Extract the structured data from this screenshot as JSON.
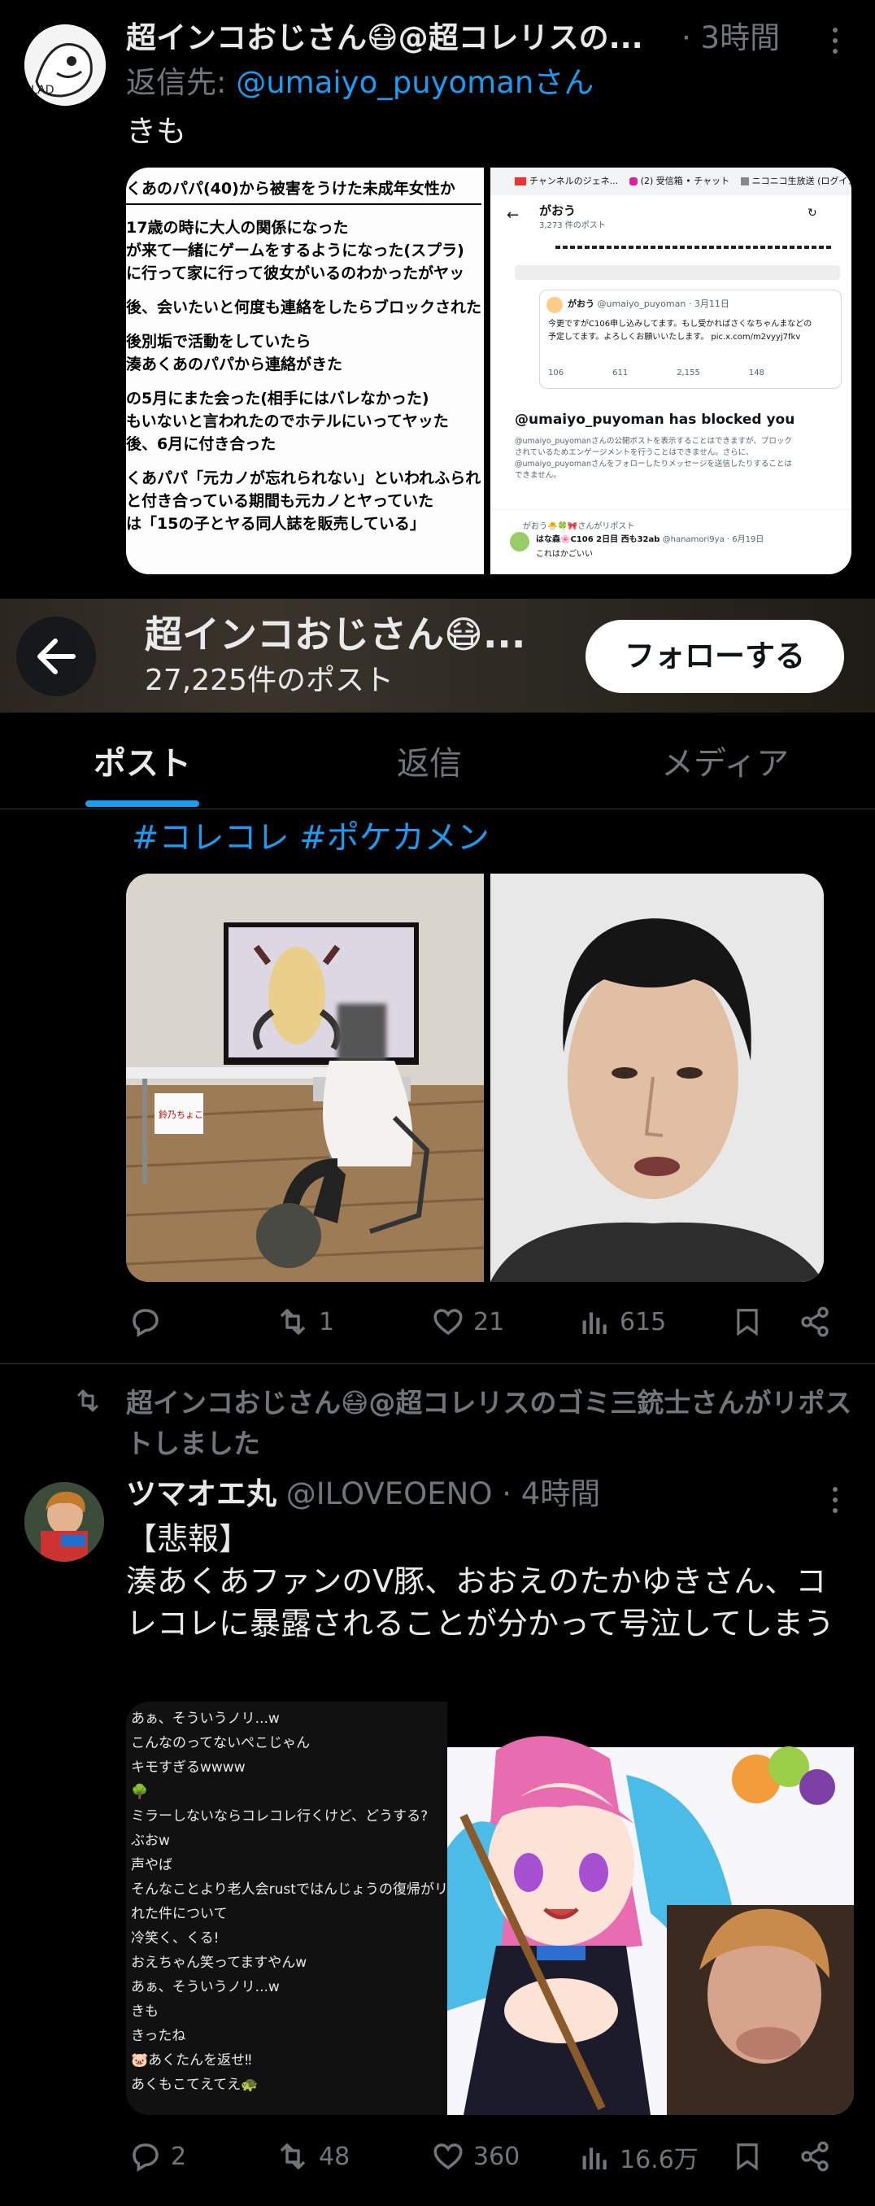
{
  "tweet1": {
    "display_name": "超インコおじさん😷@超コレリスの...",
    "time": "· 3時間",
    "reply_prefix": "返信先:",
    "reply_handle": "@umaiyo_puyomanさん",
    "text": "きも",
    "doc_lines": [
      "くあのパパ(40)から被害をうけた未成年女性か",
      "17歳の時に大人の関係になった",
      "が来て一緒にゲームをするようになった(スプラ)",
      "に行って家に行って彼女がいるのわかったがヤッ",
      "後、会いたいと何度も連絡をしたらブロックされた",
      "後別垢で活動をしていたら",
      "湊あくあのパパから連絡がきた",
      "の5月にまた会った(相手にはバレなかった)",
      "もいないと言われたのでホテルにいってヤッた",
      "後、6月に付き合った",
      "くあパパ「元カノが忘れられない」といわれふられ",
      "と付き合っている期間も元カノとヤっていた",
      "は「15の子とヤる同人誌を販売している」"
    ],
    "shot": {
      "tab1": "チャンネルのジェネ...",
      "tab2": "(2) 受信箱 • チャット",
      "tab3": "ニコニコ生放送 (ログイン...",
      "profile_name": "がおう",
      "profile_posts": "3,273 件のポスト",
      "reply_name": "がおう",
      "reply_handle": "@umaiyo_puyoman · 3月11日",
      "reply_text1": "今更ですがC106申し込みしてます。もし受かればさくなちゃんまなどの",
      "reply_text2": "予定してます。よろしくお願いいたします。 pic.x.com/m2vyyj7fkv",
      "stat1": "106",
      "stat2": "611",
      "stat3": "2,155",
      "stat4": "148",
      "blocked_title": "@umaiyo_puyoman has blocked you",
      "blocked_text1": "@umaiyo_puyomanさんの公開ポストを表示することはできますが、ブロック",
      "blocked_text2": "されているためエンゲージメントを行うことはできません。さらに、",
      "blocked_text3": "@umaiyo_puyomanさんをフォローしたりメッセージを送信したりすることは",
      "blocked_text4": "できません。",
      "repost_label": "がおう🐣🍀🎀さんがリポスト",
      "bottom_name": "はな森🌸C106 2日目 西も32ab",
      "bottom_handle": "@hanamori9ya · 6月19日",
      "bottom_text": "これはかごいい"
    }
  },
  "header": {
    "title": "超インコおじさん😷...",
    "post_count": "27,225件のポスト",
    "follow_label": "フォローする"
  },
  "tabs": [
    "ポスト",
    "返信",
    "メディア"
  ],
  "tweet2": {
    "hashtags": "#コレコレ #ポケカメン",
    "photo_sign": "鈴乃ちょこ",
    "actions": {
      "reply": "",
      "repost": "1",
      "like": "21",
      "views": "615"
    }
  },
  "tweet3": {
    "repost_banner": "超インコおじさん😷@超コレリスのゴミ三銃士さんがリポストしました",
    "display_name": "ツマオエ丸",
    "handle": "@ILOVEOENO",
    "time": "· 4時間",
    "text": "【悲報】\n湊あくあファンのV豚、おおえのたかゆきさん、コレコレに暴露されることが分かって号泣してしまう",
    "chat": [
      "あぁ、そういうノリ...w",
      "こんなのってないぺこじゃん",
      "キモすぎるwwww",
      "🌳",
      "ミラーしないならコレコレ行くけど、どうする?",
      "ぶおw",
      "声やば",
      "そんなことより老人会rustではんじょうの復帰がリークさ",
      "れた件について",
      "冷笑く、くる!",
      "おえちゃん笑ってますやんw",
      "あぁ、そういうノリ...w",
      "きも",
      "きったね",
      "🐷あくたんを返せ‼",
      "あくもこてえてえ🐢"
    ],
    "actions": {
      "reply": "2",
      "repost": "48",
      "like": "360",
      "views": "16.6万"
    }
  },
  "colors": {
    "accent": "#1d9bf0",
    "muted": "#71767b",
    "bg": "#000000",
    "divider": "#2f3336"
  }
}
